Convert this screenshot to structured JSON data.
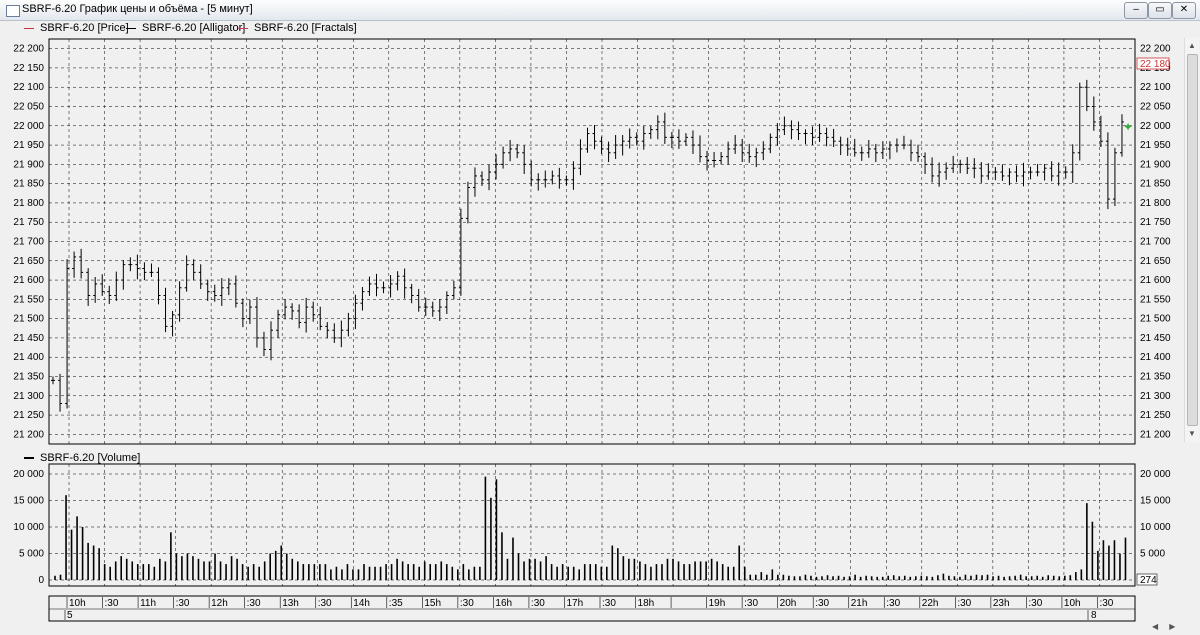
{
  "window": {
    "title": "SBRF-6.20 График цены и объёма - [5 минут]",
    "buttons": {
      "minimize": "–",
      "restore": "▭",
      "close": "✕"
    }
  },
  "price_panel": {
    "legend": [
      {
        "label": "SBRF-6.20 [Price]",
        "color": "#cc3333"
      },
      {
        "label": "SBRF-6.20 [Alligator]",
        "color": "#000000"
      },
      {
        "label": "SBRF-6.20 [Fractals]",
        "color": "#cc3355"
      }
    ],
    "y_ticks": [
      "22 200",
      "22 150",
      "22 100",
      "22 050",
      "22 000",
      "21 950",
      "21 900",
      "21 850",
      "21 800",
      "21 750",
      "21 700",
      "21 650",
      "21 600",
      "21 550",
      "21 500",
      "21 450",
      "21 400",
      "21 350",
      "21 300",
      "21 250",
      "21 200"
    ],
    "current_price": "22 180"
  },
  "volume_panel": {
    "legend": [
      {
        "label": "SBRF-6.20 [Volume]",
        "color": "#000000"
      }
    ],
    "y_ticks": [
      "20 000",
      "15 000",
      "10 000",
      "5 000",
      "0"
    ],
    "current_volume": "274"
  },
  "time_axis": {
    "labels": [
      "10h",
      ":30",
      "11h",
      ":30",
      "12h",
      ":30",
      "13h",
      ":30",
      "14h",
      ":35",
      "15h",
      ":30",
      "16h",
      ":30",
      "17h",
      ":30",
      "18h",
      "",
      "19h",
      ":30",
      "20h",
      ":30",
      "21h",
      ":30",
      "22h",
      ":30",
      "23h",
      ":30",
      "10h",
      ":30"
    ],
    "day_labels": [
      "5",
      "8"
    ]
  },
  "colors": {
    "background": "#f0f0f0",
    "grid": "#000000",
    "bars": "#000000",
    "current_price": "#cc3333",
    "fractal": "#33aa33"
  },
  "chart_data": [
    {
      "type": "ohlc",
      "title": "SBRF-6.20 [Price]",
      "x_unit": "5-minute bars",
      "ylim": [
        21175,
        22225
      ],
      "points": [
        21340,
        21280,
        21630,
        21660,
        21620,
        21560,
        21590,
        21570,
        21560,
        21600,
        21640,
        21640,
        21630,
        21620,
        21620,
        21560,
        21480,
        21510,
        21580,
        21640,
        21620,
        21590,
        21570,
        21560,
        21580,
        21590,
        21540,
        21500,
        21530,
        21450,
        21420,
        21470,
        21510,
        21530,
        21520,
        21490,
        21530,
        21510,
        21480,
        21470,
        21450,
        21470,
        21500,
        21540,
        21570,
        21590,
        21580,
        21580,
        21590,
        21610,
        21580,
        21560,
        21530,
        21530,
        21520,
        21530,
        21560,
        21580,
        21760,
        21840,
        21870,
        21860,
        21880,
        21900,
        21930,
        21940,
        21930,
        21900,
        21860,
        21860,
        21860,
        21870,
        21860,
        21860,
        21890,
        21940,
        21980,
        21960,
        21940,
        21930,
        21950,
        21960,
        21970,
        21960,
        21980,
        21990,
        22010,
        21970,
        21970,
        21960,
        21970,
        21950,
        21920,
        21910,
        21910,
        21920,
        21940,
        21950,
        21930,
        21920,
        21930,
        21940,
        21970,
        21990,
        22000,
        21990,
        21980,
        21980,
        21970,
        21980,
        21970,
        21960,
        21950,
        21940,
        21930,
        21930,
        21940,
        21930,
        21940,
        21950,
        21950,
        21950,
        21930,
        21920,
        21900,
        21870,
        21880,
        21890,
        21900,
        21900,
        21890,
        21890,
        21870,
        21880,
        21880,
        21870,
        21880,
        21870,
        21880,
        21880,
        21880,
        21890,
        21870,
        21880,
        21880,
        21930,
        22100,
        22050,
        22010,
        21960,
        21810,
        21930,
        22010
      ]
    },
    {
      "type": "bar",
      "title": "SBRF-6.20 [Volume]",
      "ylim": [
        0,
        20000
      ],
      "values": [
        800,
        1000,
        16000,
        9500,
        12000,
        10000,
        7000,
        6500,
        6000,
        3000,
        2500,
        3500,
        4500,
        4000,
        3500,
        3000,
        3000,
        3000,
        2500,
        4000,
        3500,
        9000,
        5000,
        4500,
        5000,
        4500,
        4000,
        3500,
        3500,
        5000,
        3500,
        3000,
        4500,
        4000,
        3000,
        2500,
        3000,
        2500,
        3500,
        5000,
        5500,
        6500,
        5000,
        4000,
        3500,
        3000,
        3000,
        3000,
        3000,
        3000,
        2000,
        2500,
        2000,
        3000,
        2000,
        2000,
        3000,
        2500,
        2500,
        2500,
        3000,
        3000,
        4000,
        3500,
        3000,
        3000,
        2500,
        3500,
        3000,
        3000,
        3500,
        3000,
        2500,
        2000,
        3000,
        2000,
        2500,
        2500,
        19500,
        15500,
        19000,
        9000,
        4000,
        8000,
        5000,
        3500,
        4000,
        4000,
        3500,
        4500,
        3000,
        2500,
        3000,
        2500,
        2500,
        2000,
        3000,
        3000,
        3000,
        2500,
        2500,
        6500,
        6000,
        4500,
        4000,
        4000,
        3500,
        3000,
        2500,
        3000,
        3000,
        4000,
        4000,
        3500,
        3000,
        3000,
        3500,
        3500,
        3500,
        4000,
        3500,
        3000,
        2500,
        2500,
        6500,
        2500,
        1000,
        1000,
        1500,
        1000,
        2000,
        1000,
        1000,
        800,
        700,
        700,
        1000,
        800,
        600,
        700,
        900,
        700,
        800,
        600,
        700,
        1000,
        600,
        800,
        700,
        600,
        600,
        800,
        900,
        700,
        800,
        600,
        700,
        800,
        700,
        600,
        900,
        1200,
        800,
        700,
        600,
        1000,
        800,
        1000,
        900,
        1000,
        700,
        800,
        600,
        700,
        800,
        1000,
        700,
        700,
        800,
        600,
        900,
        800,
        700,
        800,
        900,
        1500,
        2000,
        14500,
        11000,
        5500,
        7500,
        6500,
        7500,
        5000,
        8000
      ]
    }
  ]
}
